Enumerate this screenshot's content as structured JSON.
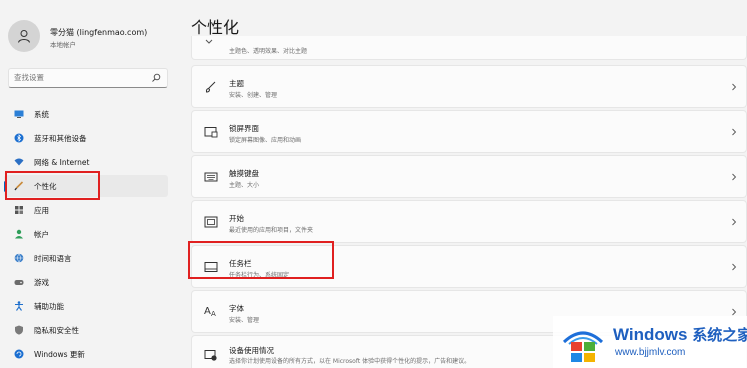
{
  "account": {
    "name": "零分猫 (lingfenmao.com)",
    "type": "本地帐户"
  },
  "search": {
    "placeholder": "查找设置"
  },
  "sidebar": {
    "items": [
      {
        "label": "系统",
        "icon": "monitor-icon"
      },
      {
        "label": "蓝牙和其他设备",
        "icon": "bluetooth-icon"
      },
      {
        "label": "网络 & Internet",
        "icon": "wifi-icon"
      },
      {
        "label": "个性化",
        "icon": "brush-icon",
        "active": true
      },
      {
        "label": "应用",
        "icon": "apps-icon"
      },
      {
        "label": "帐户",
        "icon": "person-icon"
      },
      {
        "label": "时间和语言",
        "icon": "globe-icon"
      },
      {
        "label": "游戏",
        "icon": "gamepad-icon"
      },
      {
        "label": "辅助功能",
        "icon": "accessibility-icon"
      },
      {
        "label": "隐私和安全性",
        "icon": "shield-icon"
      },
      {
        "label": "Windows 更新",
        "icon": "update-icon"
      }
    ]
  },
  "page": {
    "title": "个性化"
  },
  "cards": [
    {
      "title": "",
      "subtitle": "主题色、透明效果、对比主题",
      "icon": "color-icon"
    },
    {
      "title": "主题",
      "subtitle": "安装、创建、管理",
      "icon": "brush-icon"
    },
    {
      "title": "锁屏界面",
      "subtitle": "锁定屏幕图像、应用和动画",
      "icon": "lock-screen-icon"
    },
    {
      "title": "触摸键盘",
      "subtitle": "主题、大小",
      "icon": "keyboard-icon"
    },
    {
      "title": "开始",
      "subtitle": "最近使用的应用和项目，文件夹",
      "icon": "start-icon"
    },
    {
      "title": "任务栏",
      "subtitle": "任务栏行为、系统固定",
      "icon": "taskbar-icon"
    },
    {
      "title": "字体",
      "subtitle": "安装、管理",
      "icon": "font-icon"
    },
    {
      "title": "设备使用情况",
      "subtitle": "选择你计划使用设备的所有方式，以在 Microsoft 体验中获得个性化的提示，广告和建议。",
      "icon": "device-usage-icon"
    }
  ],
  "watermark": {
    "title_en": "Windows",
    "title_cn": "系统之家",
    "url": "www.bjjmlv.com"
  },
  "colors": {
    "accent": "#0067c0",
    "highlight": "#e02020",
    "watermark_blue": "#1e5fbf"
  }
}
